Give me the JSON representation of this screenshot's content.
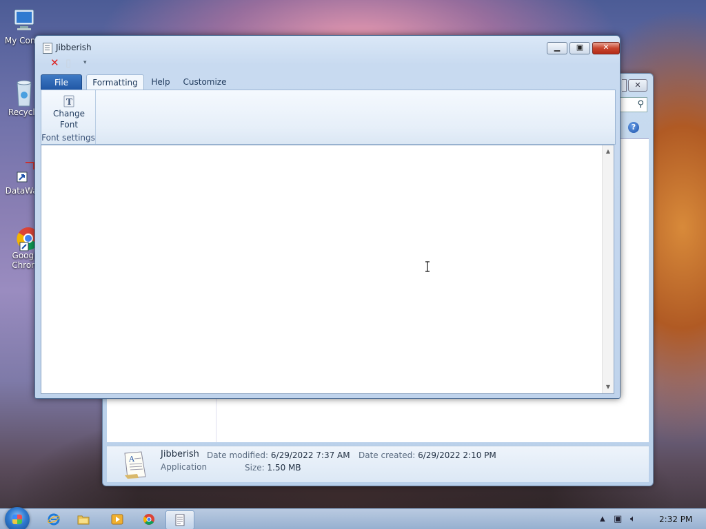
{
  "desktop": {
    "icons": [
      {
        "label": "My Comp"
      },
      {
        "label": "Recycle"
      },
      {
        "label": "DataWag"
      },
      {
        "label": "Googl"
      },
      {
        "label": "Chron"
      }
    ]
  },
  "explorer": {
    "details": {
      "name": "Jibberish",
      "type": "Application",
      "date_modified_label": "Date modified:",
      "date_modified": "6/29/2022 7:37 AM",
      "size_label": "Size:",
      "size": "1.50 MB",
      "date_created_label": "Date created:",
      "date_created": "6/29/2022 2:10 PM"
    }
  },
  "window": {
    "title": "Jibberish",
    "tabs": {
      "file": "File",
      "formatting": "Formatting",
      "help": "Help",
      "customize": "Customize"
    },
    "ribbon": {
      "change_font_line1": "Change",
      "change_font_line2": "Font",
      "group_label": "Font settings"
    }
  },
  "taskbar": {
    "clock": "2:32 PM"
  },
  "colors": {
    "accent": "#1f56a4",
    "close_button": "#c8452e"
  }
}
